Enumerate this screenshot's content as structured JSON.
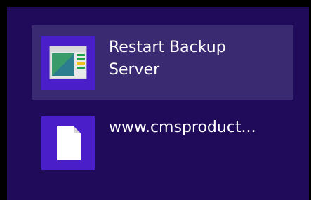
{
  "results": [
    {
      "icon": "desktop-app-icon",
      "title_line1": "Restart Backup",
      "title_line2": "Server",
      "selected": true
    },
    {
      "icon": "document-file-icon",
      "title_line1": "www.cmsproduct...",
      "selected": false
    }
  ],
  "colors": {
    "background": "#1f0b5a",
    "selected_item": "#3a2a72",
    "tile": "#4a1fc9",
    "text": "#ffffff"
  }
}
